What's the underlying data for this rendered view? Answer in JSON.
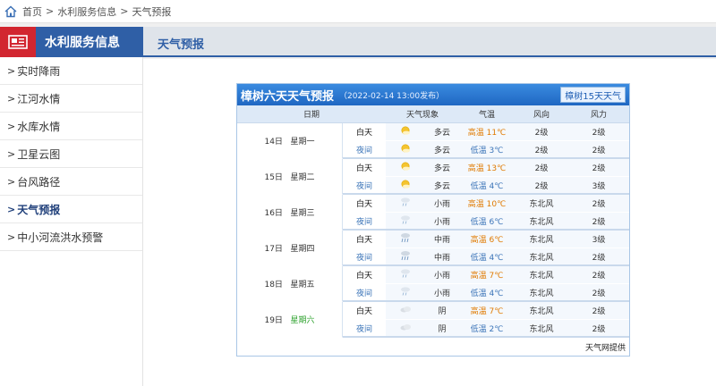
{
  "breadcrumb": {
    "home": "首页",
    "level1": "水利服务信息",
    "current": "天气预报",
    "sep": ">"
  },
  "sidebar": {
    "title": "水利服务信息",
    "items": [
      {
        "label": "实时降雨"
      },
      {
        "label": "江河水情"
      },
      {
        "label": "水库水情"
      },
      {
        "label": "卫星云图"
      },
      {
        "label": "台风路径"
      },
      {
        "label": "天气预报"
      },
      {
        "label": "中小河流洪水预警"
      }
    ],
    "active_index": 5
  },
  "tab": {
    "label": "天气预报"
  },
  "forecast": {
    "title": "樟树六天天气预报",
    "published": "（2022-02-14 13:00发布）",
    "button": "樟树15天天气",
    "headers": {
      "date": "日期",
      "phenomenon": "天气现象",
      "temp": "气温",
      "wind_dir": "风向",
      "wind_force": "风力"
    },
    "source": "天气网提供",
    "days": [
      {
        "day": "14日",
        "week": "星期一",
        "day_label": "白天",
        "night_label": "夜间",
        "day_weather": "多云",
        "night_weather": "多云",
        "day_icon": "sun-cloud-icon",
        "night_icon": "sun-cloud-icon",
        "hi_label": "高温",
        "hi": "11℃",
        "lo_label": "低温",
        "lo": "3℃",
        "day_wdir": "2级",
        "night_wdir": "2级",
        "day_wf": "2级",
        "night_wf": "2级"
      },
      {
        "day": "15日",
        "week": "星期二",
        "day_label": "白天",
        "night_label": "夜间",
        "day_weather": "多云",
        "night_weather": "多云",
        "day_icon": "sun-cloud-icon",
        "night_icon": "sun-cloud-icon",
        "hi_label": "高温",
        "hi": "13℃",
        "lo_label": "低温",
        "lo": "4℃",
        "day_wdir": "2级",
        "night_wdir": "2级",
        "day_wf": "2级",
        "night_wf": "3级"
      },
      {
        "day": "16日",
        "week": "星期三",
        "day_label": "白天",
        "night_label": "夜间",
        "day_weather": "小雨",
        "night_weather": "小雨",
        "day_icon": "light-rain-icon",
        "night_icon": "light-rain-icon",
        "hi_label": "高温",
        "hi": "10℃",
        "lo_label": "低温",
        "lo": "6℃",
        "day_wdir": "东北风",
        "night_wdir": "东北风",
        "day_wf": "2级",
        "night_wf": "2级"
      },
      {
        "day": "17日",
        "week": "星期四",
        "day_label": "白天",
        "night_label": "夜间",
        "day_weather": "中雨",
        "night_weather": "中雨",
        "day_icon": "moderate-rain-icon",
        "night_icon": "moderate-rain-icon",
        "hi_label": "高温",
        "hi": "6℃",
        "lo_label": "低温",
        "lo": "4℃",
        "day_wdir": "东北风",
        "night_wdir": "东北风",
        "day_wf": "3级",
        "night_wf": "2级"
      },
      {
        "day": "18日",
        "week": "星期五",
        "day_label": "白天",
        "night_label": "夜间",
        "day_weather": "小雨",
        "night_weather": "小雨",
        "day_icon": "light-rain-icon",
        "night_icon": "light-rain-icon",
        "hi_label": "高温",
        "hi": "7℃",
        "lo_label": "低温",
        "lo": "4℃",
        "day_wdir": "东北风",
        "night_wdir": "东北风",
        "day_wf": "2级",
        "night_wf": "2级"
      },
      {
        "day": "19日",
        "week": "星期六",
        "day_label": "白天",
        "night_label": "夜间",
        "day_weather": "阴",
        "night_weather": "阴",
        "day_icon": "overcast-icon",
        "night_icon": "overcast-icon",
        "hi_label": "高温",
        "hi": "7℃",
        "lo_label": "低温",
        "lo": "2℃",
        "day_wdir": "东北风",
        "night_wdir": "东北风",
        "day_wf": "2级",
        "night_wf": "2级"
      }
    ]
  },
  "colors": {
    "brand_blue": "#2f5fa6",
    "brand_red": "#d22630",
    "hi_temp": "#e07a00",
    "lo_temp": "#3b74b8",
    "saturday": "#2aa02a"
  }
}
